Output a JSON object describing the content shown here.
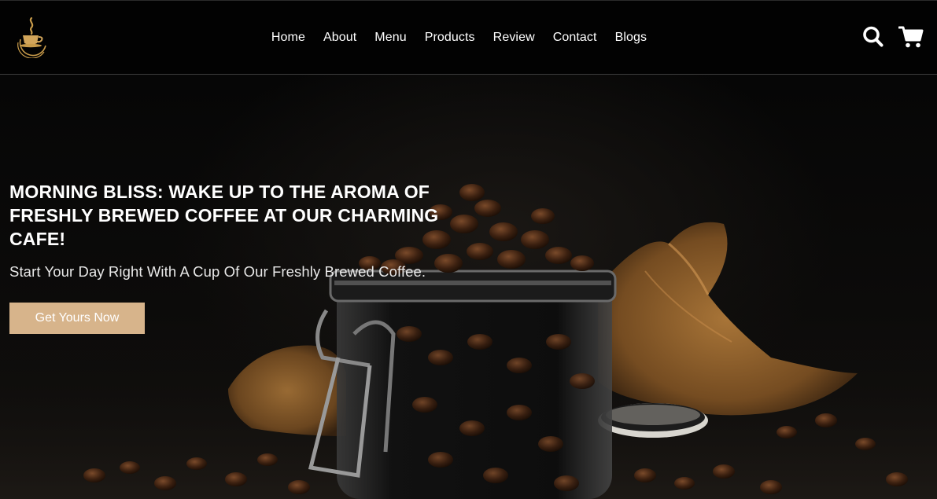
{
  "header": {
    "logo": {
      "name": "coffee-cup-logo"
    },
    "nav": [
      {
        "label": "Home"
      },
      {
        "label": "About"
      },
      {
        "label": "Menu"
      },
      {
        "label": "Products"
      },
      {
        "label": "Review"
      },
      {
        "label": "Contact"
      },
      {
        "label": "Blogs"
      }
    ],
    "icons": {
      "search": "search-icon",
      "cart": "cart-icon"
    }
  },
  "hero": {
    "title": "Morning Bliss: Wake Up To The Aroma Of Freshly Brewed Coffee At Our Charming Cafe!",
    "subtitle": "Start Your Day Right With A Cup Of Our Freshly Brewed Coffee.",
    "cta_label": "Get Yours Now",
    "image": "coffee-beans-jar-photo"
  },
  "colors": {
    "background": "#000000",
    "accent": "#d7b48b",
    "logo_gold": "#c89b4a",
    "text": "#ffffff"
  }
}
